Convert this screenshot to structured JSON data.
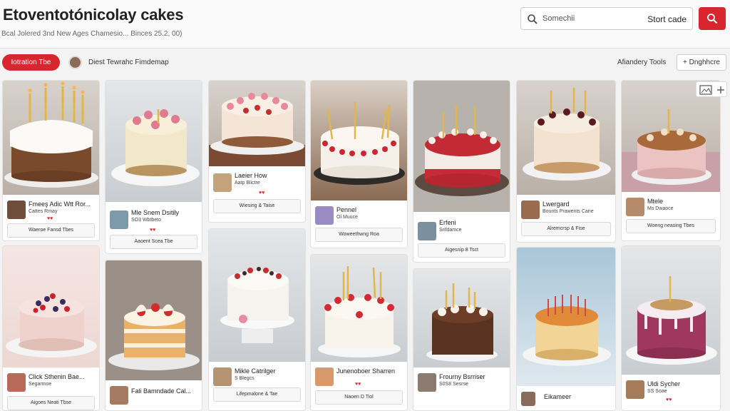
{
  "header": {
    "title": "Etoventotónicolay cakes",
    "subtitle": "Bcal Jolered 3nd New Ages   Chamesio...   Binces 25.2, 00)",
    "search_placeholder": "Somechii",
    "search_button": "Stort cade"
  },
  "toolbar": {
    "pill_label": "Iotration Tbe",
    "owner_text": "Diest Tewrahc Fimdemap",
    "advanced_label": "Afiandery Tools",
    "options_button": "+ Dnghhcre"
  },
  "pins": [
    {
      "name": "Fmeeş Adic Wtt Ror...",
      "sub": "Cattes Rmay",
      "action": "Waeroe Fansd Tbes",
      "heart": "♥♥"
    },
    {
      "name": "Mle Snem Dsitily",
      "sub": "SO3 Wbtbeto",
      "action": "Aaoent Scea Tbe",
      "heart": "♥♥"
    },
    {
      "name": "Laeier How",
      "sub": "Aatp Blictre",
      "action": "Wiesing & Taise",
      "heart": "♥♥"
    },
    {
      "name": "Pennel",
      "sub": "Ol Muuce",
      "action": "Woweethwng Roa",
      "heart": "♥♥"
    },
    {
      "name": "Erfeni",
      "sub": "Srifdamce",
      "action": "Aigesnip 8 Tsct",
      "heart": "♥♥"
    },
    {
      "name": "Lwergard",
      "sub": "Bounts Prawents Cane",
      "action": "Alremcrsp & Fise",
      "heart": "♥♥"
    },
    {
      "name": "Mtele",
      "sub": "Ms Dwaoce",
      "action": "Woeng neasing Tbes",
      "heart": "♥♥"
    },
    {
      "name": "Click Sthenin Bae...",
      "sub": "Segarmoe",
      "action": "Aigoes Neati Tbse",
      "heart": "♥♥"
    },
    {
      "name": "Fali Bamndade Cal...",
      "sub": "",
      "action": "",
      "heart": ""
    },
    {
      "name": "Mikle Catrilger",
      "sub": "S Blegcs",
      "action": "Lifepmalone & Tae",
      "heart": "♥♥"
    },
    {
      "name": "Junenoboer Sharren",
      "sub": "",
      "action": "Naoen D Tiol",
      "heart": "♥♥"
    },
    {
      "name": "Frourny Bsrriser",
      "sub": "S0S8 Sesrse",
      "action": "",
      "heart": ""
    },
    {
      "name": "Eikameer",
      "sub": "",
      "action": "",
      "heart": ""
    },
    {
      "name": "Uldi Sycher",
      "sub": "SS Soae",
      "action": "",
      "heart": "♥♥"
    }
  ],
  "colors": {
    "accent": "#d9252d"
  }
}
